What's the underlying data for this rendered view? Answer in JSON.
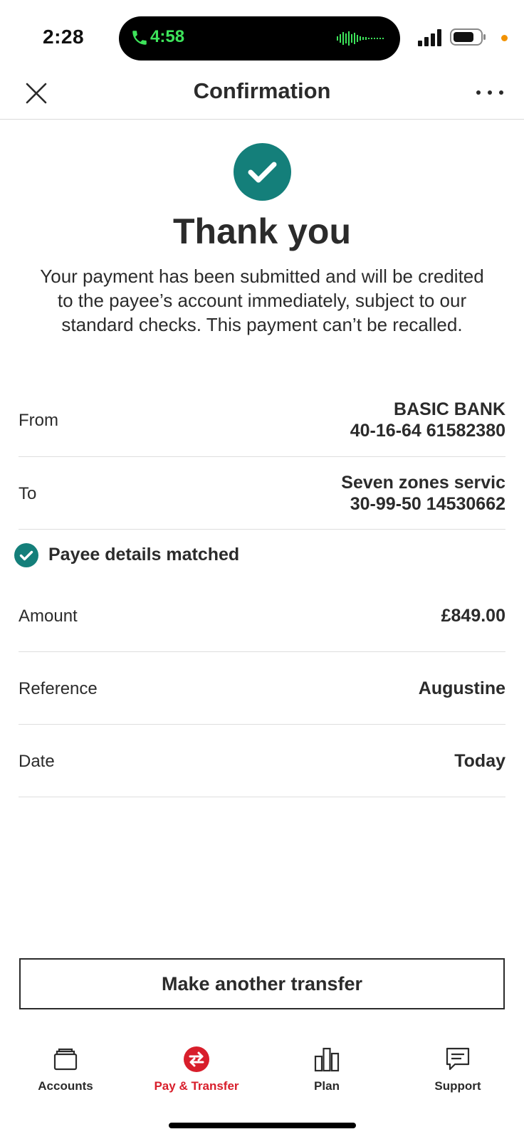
{
  "status_bar": {
    "time": "2:28",
    "call_timer": "4:58",
    "call_accent": "#3de35a",
    "privacy_dot": "#f29200"
  },
  "header": {
    "title": "Confirmation",
    "close_icon": "close-icon",
    "more_icon": "more-horizontal-icon"
  },
  "success": {
    "icon": "check-circle-icon",
    "title": "Thank you",
    "message": "Your payment has been submitted and will be credited to the payee’s account immediately, subject to our standard checks. This payment can’t be recalled."
  },
  "details": {
    "from": {
      "label": "From",
      "line1": "BASIC BANK",
      "line2": "40-16-64 61582380"
    },
    "to": {
      "label": "To",
      "line1": "Seven zones servic",
      "line2": "30-99-50 14530662"
    },
    "payee_match": "Payee details matched",
    "amount": {
      "label": "Amount",
      "value": "£849.00"
    },
    "reference": {
      "label": "Reference",
      "value": "Augustine"
    },
    "date": {
      "label": "Date",
      "value": "Today"
    }
  },
  "actions": {
    "make_another": "Make another transfer"
  },
  "nav": {
    "accounts": "Accounts",
    "pay_transfer": "Pay & Transfer",
    "plan": "Plan",
    "support": "Support",
    "active": "Pay & Transfer"
  },
  "colors": {
    "success_teal": "#147f7a",
    "brand_red": "#d81e2b",
    "text": "#2b2b2b"
  }
}
